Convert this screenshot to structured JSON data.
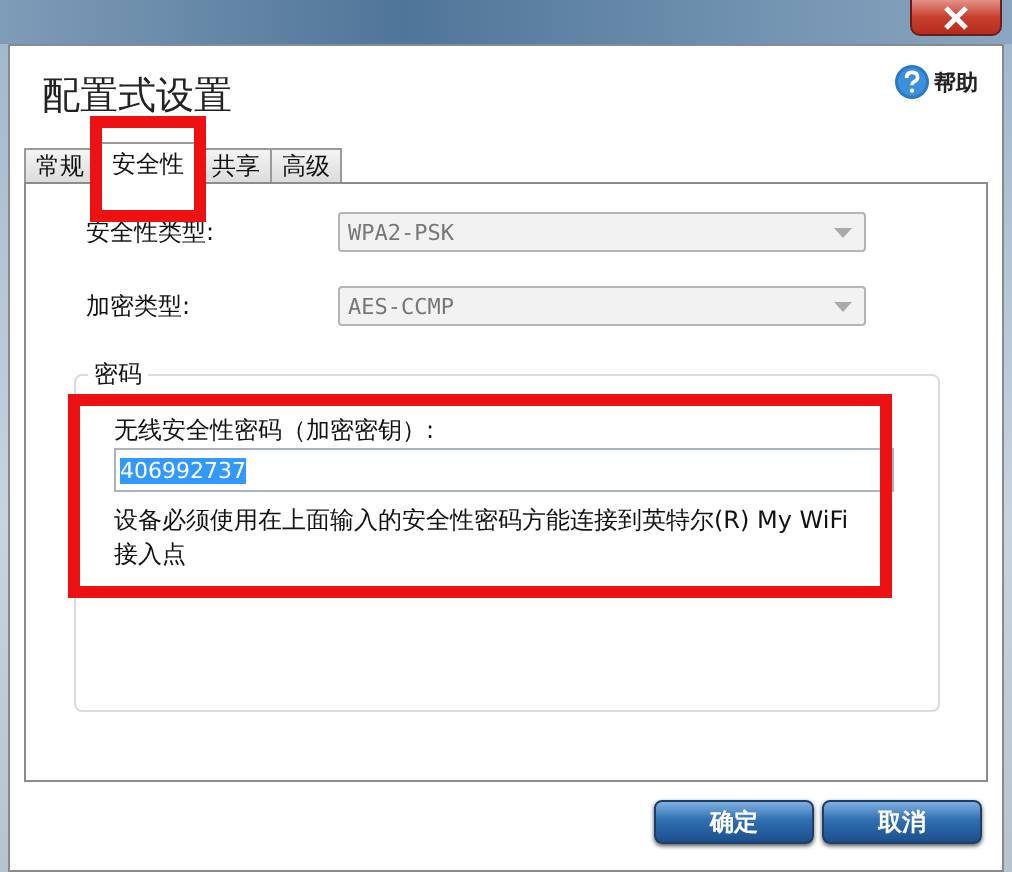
{
  "window": {
    "title": "配置式设置",
    "help": "帮助"
  },
  "tabs": [
    {
      "label": "常规",
      "selected": false
    },
    {
      "label": "安全性",
      "selected": true
    },
    {
      "label": "共享",
      "selected": false
    },
    {
      "label": "高级",
      "selected": false
    }
  ],
  "fields": [
    {
      "label": "安全性类型:",
      "value": "WPA2-PSK",
      "disabled": true
    },
    {
      "label": "加密类型:",
      "value": "AES-CCMP",
      "disabled": true
    }
  ],
  "password": {
    "group": "密码",
    "label": "无线安全性密码（加密密钥）:",
    "value": "406992737",
    "value_selected": true,
    "note": "设备必须使用在上面输入的安全性密码方能连接到英特尔(R) My WiFi 接入点"
  },
  "buttons": [
    "确定",
    "取消"
  ]
}
